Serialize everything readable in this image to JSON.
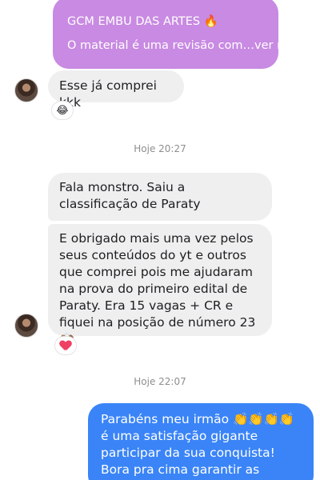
{
  "story_reply": {
    "title": "GCM EMBU DAS ARTES 🔥",
    "preview": "O material é uma revisão com…ver mais"
  },
  "messages": [
    {
      "sender": "them",
      "text": "Esse já comprei kkk",
      "reaction": "😂"
    },
    {
      "sender": "them",
      "text": "Fala monstro. Saiu a classificação de Paraty"
    },
    {
      "sender": "them",
      "text": "E obrigado mais uma vez pelos seus conteúdos do yt e outros que comprei pois me ajudaram na prova do primeiro edital de Paraty. Era 15 vagas + CR e fiquei na posição de número 23 🙌🏾",
      "reaction": "heart"
    },
    {
      "sender": "me",
      "text": "Parabéns meu irmão 👏👏👏👏 é uma satisfação gigante participar da sua conquista! Bora pra cima garantir as próximas etapas!!! 👊🏻"
    }
  ],
  "timestamps": [
    "Hoje 20:27",
    "Hoje 22:07"
  ],
  "colors": {
    "story_bubble": "#c88ae2",
    "incoming_bubble": "#efefef",
    "outgoing_bubble": "#3a84f7",
    "timestamp_text": "#8e8e8e"
  }
}
